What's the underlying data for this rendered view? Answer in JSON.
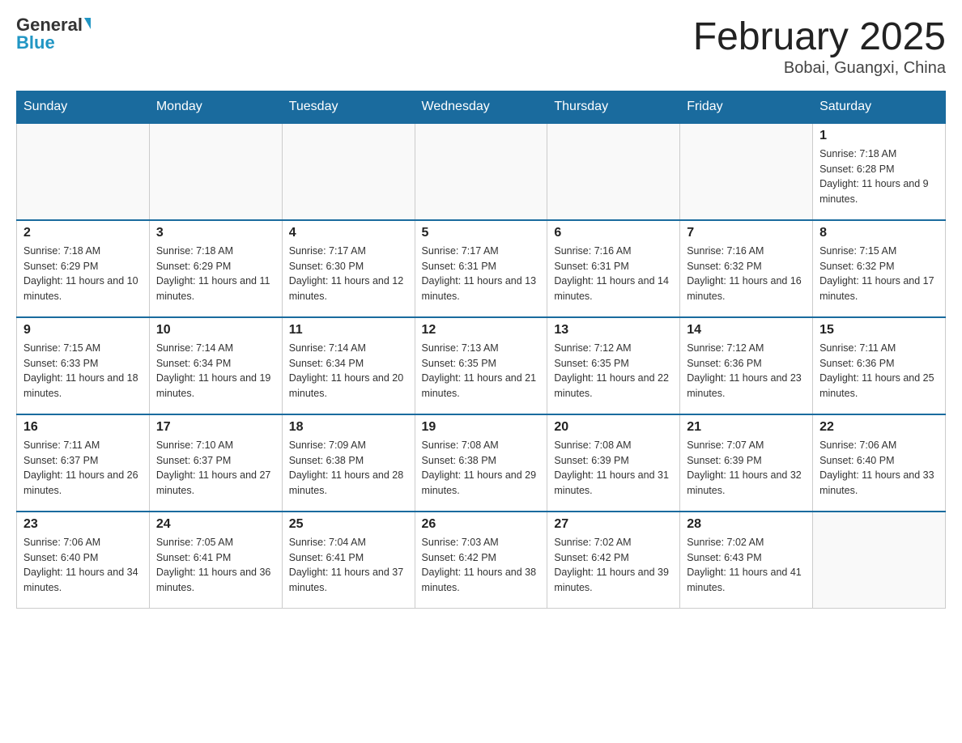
{
  "header": {
    "logo_general": "General",
    "logo_blue": "Blue",
    "month_title": "February 2025",
    "location": "Bobai, Guangxi, China"
  },
  "days_of_week": [
    "Sunday",
    "Monday",
    "Tuesday",
    "Wednesday",
    "Thursday",
    "Friday",
    "Saturday"
  ],
  "weeks": [
    [
      {
        "day": "",
        "info": ""
      },
      {
        "day": "",
        "info": ""
      },
      {
        "day": "",
        "info": ""
      },
      {
        "day": "",
        "info": ""
      },
      {
        "day": "",
        "info": ""
      },
      {
        "day": "",
        "info": ""
      },
      {
        "day": "1",
        "info": "Sunrise: 7:18 AM\nSunset: 6:28 PM\nDaylight: 11 hours and 9 minutes."
      }
    ],
    [
      {
        "day": "2",
        "info": "Sunrise: 7:18 AM\nSunset: 6:29 PM\nDaylight: 11 hours and 10 minutes."
      },
      {
        "day": "3",
        "info": "Sunrise: 7:18 AM\nSunset: 6:29 PM\nDaylight: 11 hours and 11 minutes."
      },
      {
        "day": "4",
        "info": "Sunrise: 7:17 AM\nSunset: 6:30 PM\nDaylight: 11 hours and 12 minutes."
      },
      {
        "day": "5",
        "info": "Sunrise: 7:17 AM\nSunset: 6:31 PM\nDaylight: 11 hours and 13 minutes."
      },
      {
        "day": "6",
        "info": "Sunrise: 7:16 AM\nSunset: 6:31 PM\nDaylight: 11 hours and 14 minutes."
      },
      {
        "day": "7",
        "info": "Sunrise: 7:16 AM\nSunset: 6:32 PM\nDaylight: 11 hours and 16 minutes."
      },
      {
        "day": "8",
        "info": "Sunrise: 7:15 AM\nSunset: 6:32 PM\nDaylight: 11 hours and 17 minutes."
      }
    ],
    [
      {
        "day": "9",
        "info": "Sunrise: 7:15 AM\nSunset: 6:33 PM\nDaylight: 11 hours and 18 minutes."
      },
      {
        "day": "10",
        "info": "Sunrise: 7:14 AM\nSunset: 6:34 PM\nDaylight: 11 hours and 19 minutes."
      },
      {
        "day": "11",
        "info": "Sunrise: 7:14 AM\nSunset: 6:34 PM\nDaylight: 11 hours and 20 minutes."
      },
      {
        "day": "12",
        "info": "Sunrise: 7:13 AM\nSunset: 6:35 PM\nDaylight: 11 hours and 21 minutes."
      },
      {
        "day": "13",
        "info": "Sunrise: 7:12 AM\nSunset: 6:35 PM\nDaylight: 11 hours and 22 minutes."
      },
      {
        "day": "14",
        "info": "Sunrise: 7:12 AM\nSunset: 6:36 PM\nDaylight: 11 hours and 23 minutes."
      },
      {
        "day": "15",
        "info": "Sunrise: 7:11 AM\nSunset: 6:36 PM\nDaylight: 11 hours and 25 minutes."
      }
    ],
    [
      {
        "day": "16",
        "info": "Sunrise: 7:11 AM\nSunset: 6:37 PM\nDaylight: 11 hours and 26 minutes."
      },
      {
        "day": "17",
        "info": "Sunrise: 7:10 AM\nSunset: 6:37 PM\nDaylight: 11 hours and 27 minutes."
      },
      {
        "day": "18",
        "info": "Sunrise: 7:09 AM\nSunset: 6:38 PM\nDaylight: 11 hours and 28 minutes."
      },
      {
        "day": "19",
        "info": "Sunrise: 7:08 AM\nSunset: 6:38 PM\nDaylight: 11 hours and 29 minutes."
      },
      {
        "day": "20",
        "info": "Sunrise: 7:08 AM\nSunset: 6:39 PM\nDaylight: 11 hours and 31 minutes."
      },
      {
        "day": "21",
        "info": "Sunrise: 7:07 AM\nSunset: 6:39 PM\nDaylight: 11 hours and 32 minutes."
      },
      {
        "day": "22",
        "info": "Sunrise: 7:06 AM\nSunset: 6:40 PM\nDaylight: 11 hours and 33 minutes."
      }
    ],
    [
      {
        "day": "23",
        "info": "Sunrise: 7:06 AM\nSunset: 6:40 PM\nDaylight: 11 hours and 34 minutes."
      },
      {
        "day": "24",
        "info": "Sunrise: 7:05 AM\nSunset: 6:41 PM\nDaylight: 11 hours and 36 minutes."
      },
      {
        "day": "25",
        "info": "Sunrise: 7:04 AM\nSunset: 6:41 PM\nDaylight: 11 hours and 37 minutes."
      },
      {
        "day": "26",
        "info": "Sunrise: 7:03 AM\nSunset: 6:42 PM\nDaylight: 11 hours and 38 minutes."
      },
      {
        "day": "27",
        "info": "Sunrise: 7:02 AM\nSunset: 6:42 PM\nDaylight: 11 hours and 39 minutes."
      },
      {
        "day": "28",
        "info": "Sunrise: 7:02 AM\nSunset: 6:43 PM\nDaylight: 11 hours and 41 minutes."
      },
      {
        "day": "",
        "info": ""
      }
    ]
  ]
}
